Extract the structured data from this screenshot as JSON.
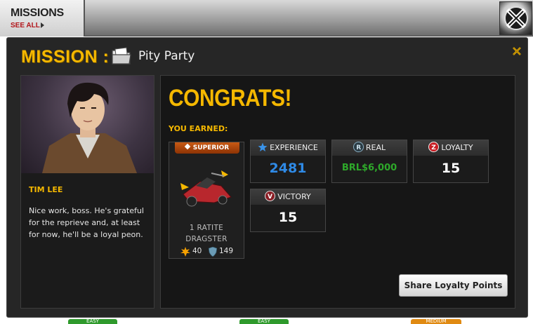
{
  "topbar": {
    "missions_label": "MISSIONS",
    "see_all_label": "SEE ALL",
    "badge_icon": "x-men-icon"
  },
  "mission": {
    "prefix": "MISSION :",
    "name": "Pity Party",
    "close_icon": "close-icon"
  },
  "character": {
    "name": "TIM LEE",
    "message": "Nice work, boss. He's grateful for the reprieve and, at least for now, he'll be a loyal peon."
  },
  "rewards": {
    "headline": "CONGRATS!",
    "earned_label": "YOU EARNED:",
    "item": {
      "rarity": "SUPERIOR",
      "name": "1 RATITE DRAGSTER",
      "attack": "40",
      "defense": "149"
    },
    "stats": [
      {
        "label": "EXPERIENCE",
        "value": "2481",
        "icon": "star-icon",
        "color": "#2f8ae6"
      },
      {
        "label": "REAL",
        "value": "BRL$6,000",
        "icon": "real-currency-icon",
        "color": "#2ea82a"
      },
      {
        "label": "LOYALTY",
        "value": "15",
        "icon": "loyalty-icon",
        "color": "#ffffff"
      },
      {
        "label": "VICTORY",
        "value": "15",
        "icon": "victory-icon",
        "color": "#ffffff"
      }
    ],
    "share_button": "Share Loyalty Points"
  },
  "bottom_tabs": [
    {
      "label": "EASY",
      "color": "#2f9a2c"
    },
    {
      "label": "EASY",
      "color": "#2f9a2c"
    },
    {
      "label": "MEDIUM",
      "color": "#e08a12"
    }
  ]
}
